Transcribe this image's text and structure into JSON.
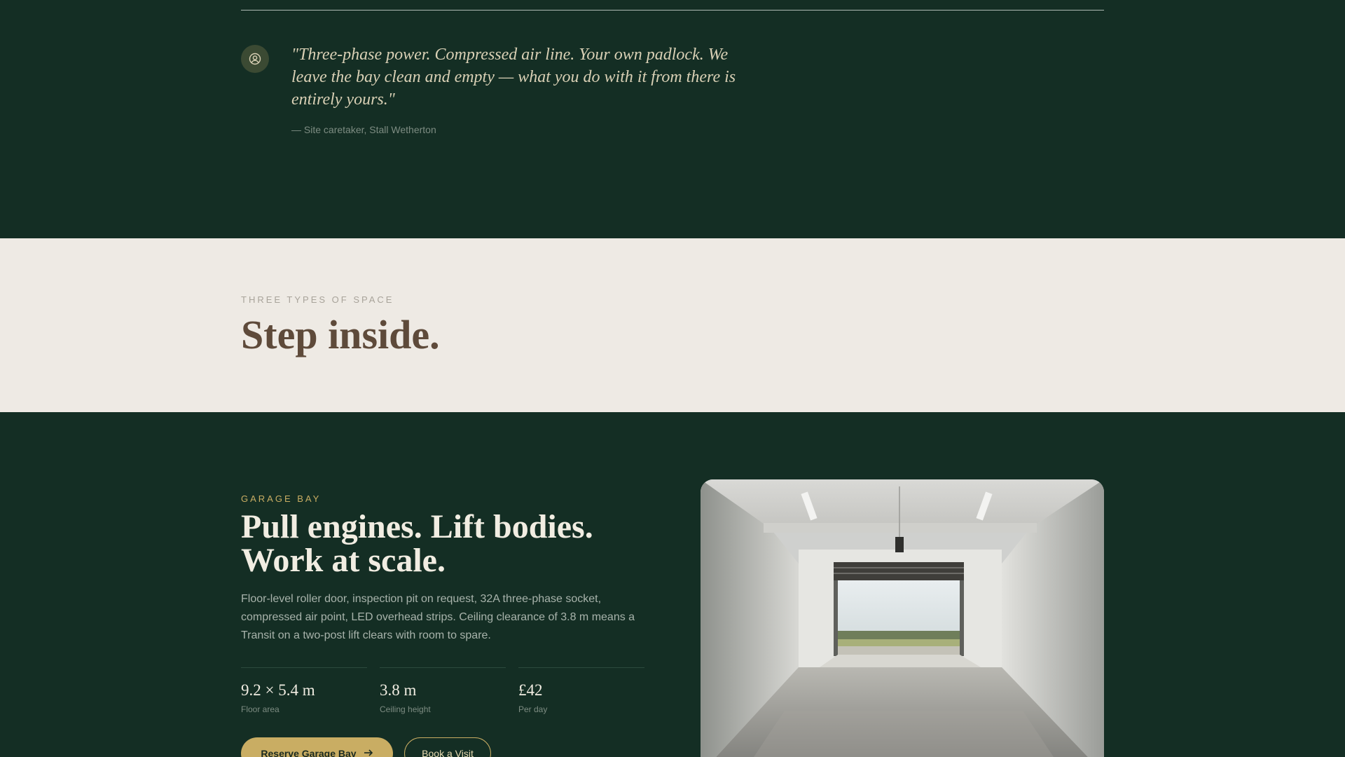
{
  "testimonial": {
    "quote": "\"Three-phase power. Compressed air line. Your own padlock. We leave the bay clean and empty — what you do with it from there is entirely yours.\"",
    "attribution": "— Site caretaker, Stall Wetherton",
    "avatar_icon": "user-circle-icon"
  },
  "types": {
    "eyebrow": "THREE TYPES OF SPACE",
    "title": "Step inside."
  },
  "feature": {
    "eyebrow": "GARAGE BAY",
    "title_line1": "Pull engines. Lift bodies.",
    "title_line2": "Work at scale.",
    "description": "Floor-level roller door, inspection pit on request, 32A three-phase socket, compressed air point, LED overhead strips. Ceiling clearance of 3.8 m means a Transit on a two-post lift clears with room to spare.",
    "stats": [
      {
        "value": "9.2 × 5.4 m",
        "label": "Floor area"
      },
      {
        "value": "3.8 m",
        "label": "Ceiling height"
      },
      {
        "value": "£42",
        "label": "Per day"
      }
    ],
    "primary_cta": "Reserve Garage Bay",
    "primary_cta_icon": "arrow-right-icon",
    "secondary_cta": "Book a Visit",
    "photo_alt": "Empty garage bay with open roller door"
  },
  "colors": {
    "forest": "#142e24",
    "cream": "#eeeae4",
    "gold": "#c9ad63",
    "brown": "#5e4a3a"
  }
}
